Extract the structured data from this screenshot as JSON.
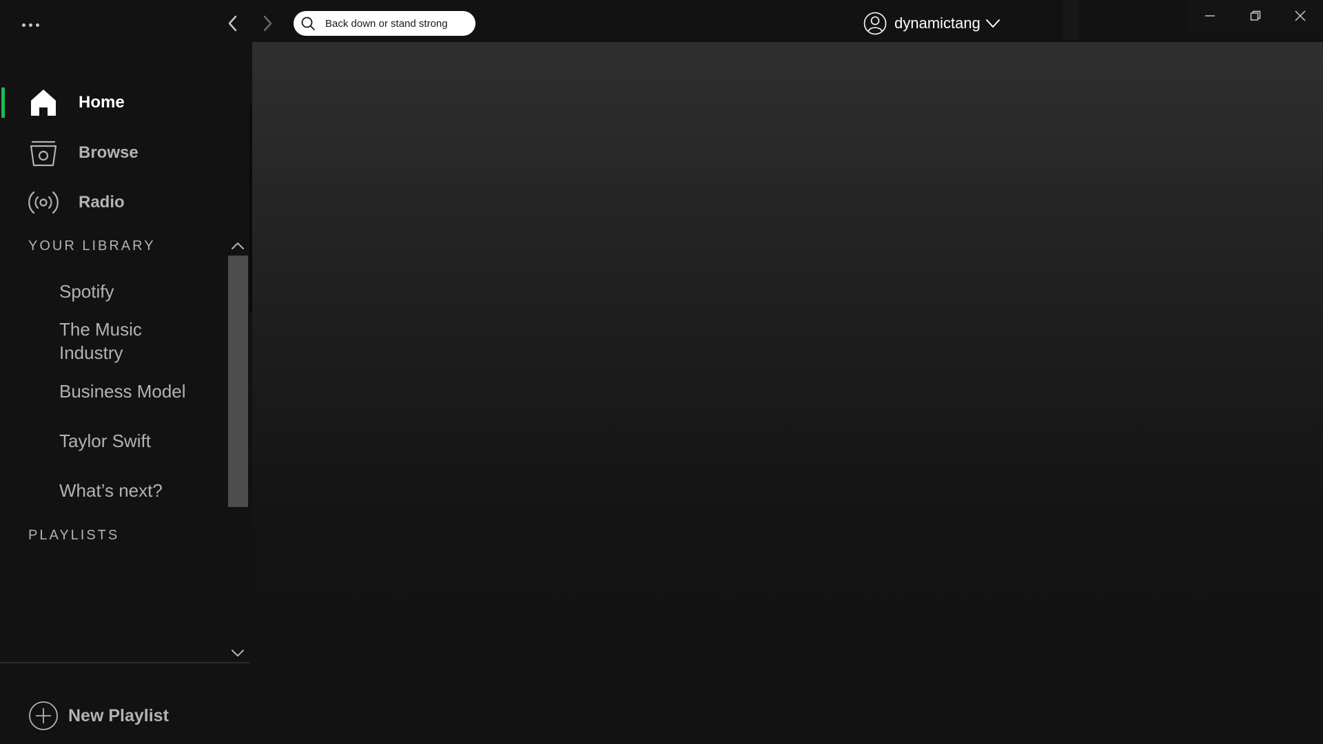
{
  "app": {
    "accent_color": "#1db954",
    "background_color": "#121212"
  },
  "topbar": {
    "menu_icon": "more-dots-icon",
    "back_icon": "chevron-left-icon",
    "forward_icon": "chevron-right-icon",
    "search": {
      "value": "Back down or stand strong",
      "icon": "search-icon"
    },
    "user": {
      "name": "dynamictang",
      "avatar_icon": "user-avatar-icon",
      "dropdown_icon": "chevron-down-icon"
    },
    "window_controls": [
      "minimize-icon",
      "restore-icon",
      "close-icon"
    ]
  },
  "sidebar": {
    "nav": [
      {
        "label": "Home",
        "icon": "home-icon",
        "active": true
      },
      {
        "label": "Browse",
        "icon": "browse-icon",
        "active": false
      },
      {
        "label": "Radio",
        "icon": "radio-icon",
        "active": false
      }
    ],
    "library": {
      "heading": "YOUR LIBRARY",
      "items": [
        {
          "label": "Spotify"
        },
        {
          "label": "The Music Industry"
        },
        {
          "label": "Business Model"
        },
        {
          "label": "Taylor Swift"
        },
        {
          "label": "What’s next?"
        }
      ]
    },
    "playlists": {
      "heading": "PLAYLISTS",
      "items": []
    },
    "new_playlist": {
      "label": "New Playlist",
      "icon": "plus-circle-icon"
    }
  }
}
